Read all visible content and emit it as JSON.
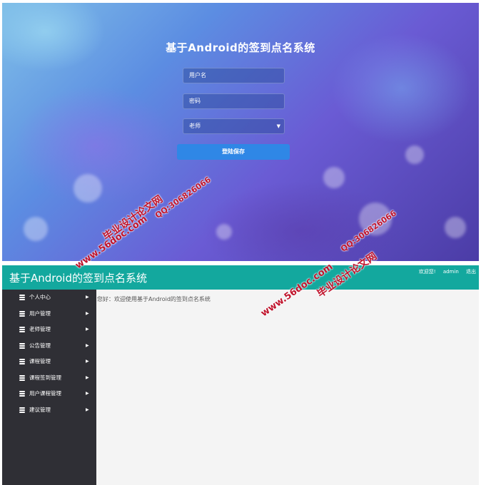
{
  "login": {
    "title": "基于Android的签到点名系统",
    "username_placeholder": "用户名",
    "password_placeholder": "密码",
    "role_selected": "老师",
    "submit_label": "登陆保存"
  },
  "admin": {
    "app_title": "基于Android的签到点名系统",
    "header_welcome": "欢迎您!",
    "header_user": "admin",
    "header_logout": "退出",
    "welcome_text": "您好：欢迎使用基于Android的签到点名系统",
    "menu": [
      {
        "label": "个人中心"
      },
      {
        "label": "用户管理"
      },
      {
        "label": "老师管理"
      },
      {
        "label": "公告管理"
      },
      {
        "label": "课程管理"
      },
      {
        "label": "课程签到管理"
      },
      {
        "label": "用户课程管理"
      },
      {
        "label": "建议管理"
      }
    ]
  },
  "watermark": {
    "site": "www.56doc.com",
    "qq": "QQ:306826066",
    "cn": "毕业设计论文网"
  },
  "colors": {
    "topbar": "#13a89e",
    "sidebar": "#2f2f35",
    "login_button": "#2f87e6",
    "watermark": "#c0142c"
  }
}
